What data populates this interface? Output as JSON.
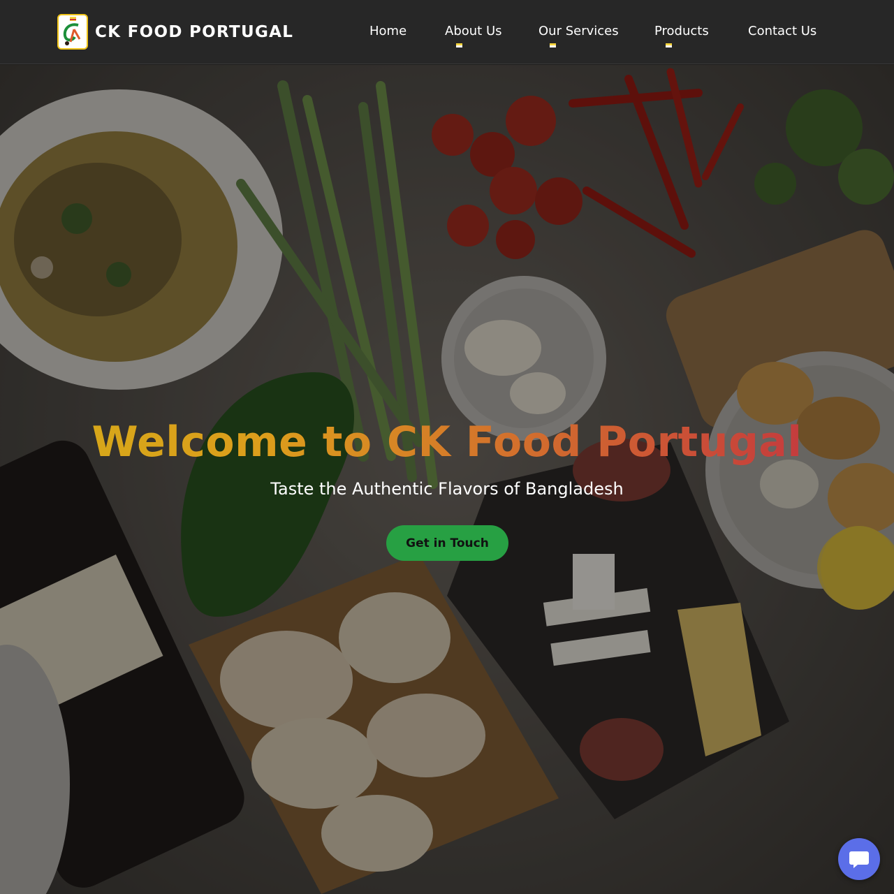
{
  "brand": {
    "name": "CK FOOD PORTUGAL",
    "logo_icon": "ck-logo-icon"
  },
  "nav": {
    "items": [
      {
        "label": "Home",
        "has_flag": false
      },
      {
        "label": "About Us",
        "has_flag": true
      },
      {
        "label": "Our Services",
        "has_flag": true
      },
      {
        "label": "Products",
        "has_flag": true
      },
      {
        "label": "Contact Us",
        "has_flag": false
      }
    ]
  },
  "hero": {
    "title": "Welcome to CK Food Portugal",
    "subtitle": "Taste the Authentic Flavors of Bangladesh",
    "cta_label": "Get in Touch",
    "background": "food-table-photo"
  },
  "chat": {
    "icon": "chat-bubble-icon"
  },
  "colors": {
    "header_bg": "#272727",
    "cta_bg": "#27a043",
    "chat_bg": "#5b6ee8",
    "title_gradient_start": "#e0b51a",
    "title_gradient_end": "#c9314a"
  }
}
